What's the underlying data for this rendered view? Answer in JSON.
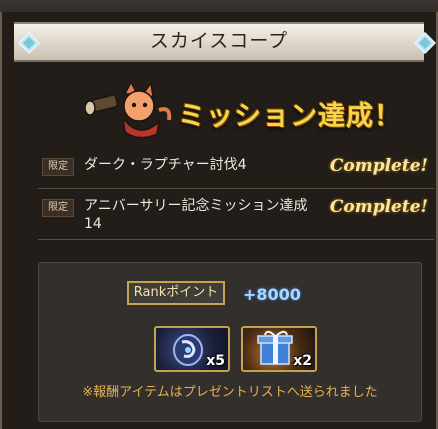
{
  "header": {
    "title": "スカイスコープ"
  },
  "banner": {
    "title": "ミッション達成！"
  },
  "missions": [
    {
      "badge": "限定",
      "name": "ダーク・ラプチャー討伐4",
      "status": "Complete!"
    },
    {
      "badge": "限定",
      "name": "アニバーサリー記念ミッション達成14",
      "status": "Complete!"
    }
  ],
  "reward": {
    "rank_label": "Rankポイント",
    "rank_value": "+8000",
    "items": [
      {
        "icon": "crystal-item-icon",
        "count": "x5"
      },
      {
        "icon": "gift-box-icon",
        "count": "x2"
      }
    ],
    "note": "※報酬アイテムはプレゼントリストへ送られました"
  },
  "colors": {
    "accent_gold": "#f5d64a",
    "complete_text": "#f9e7a6",
    "rank_value": "#a9d6ff",
    "note_text": "#e6b24f"
  }
}
